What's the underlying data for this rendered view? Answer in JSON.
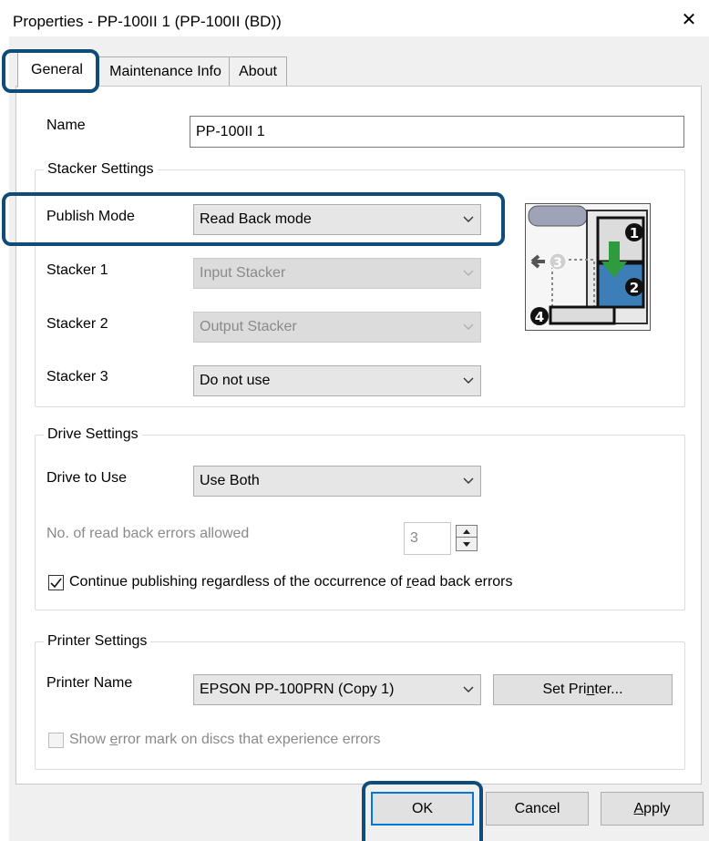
{
  "window": {
    "title": "Properties - PP-100II 1 (PP-100II (BD))",
    "close_glyph": "✕"
  },
  "tabs": [
    {
      "label": "General",
      "active": true
    },
    {
      "label": "Maintenance Info",
      "active": false
    },
    {
      "label": "About",
      "active": false
    }
  ],
  "general": {
    "name_label": "Name",
    "name_value": "PP-100II 1"
  },
  "stacker": {
    "group_title": "Stacker Settings",
    "publish_mode_label": "Publish Mode",
    "publish_mode_value": "Read Back mode",
    "stacker1_label": "Stacker 1",
    "stacker1_value": "Input Stacker",
    "stacker2_label": "Stacker 2",
    "stacker2_value": "Output Stacker",
    "stacker3_label": "Stacker 3",
    "stacker3_value": "Do not use",
    "diagram_numbers": [
      "1",
      "2",
      "3",
      "4"
    ]
  },
  "drive": {
    "group_title": "Drive Settings",
    "drive_label": "Drive to Use",
    "drive_value": "Use Both",
    "errors_label": "No. of read back errors allowed",
    "errors_value": "3",
    "continue_checked": true,
    "continue_label_pre": "Continue publishing regardless of the occurrence of ",
    "continue_label_key": "r",
    "continue_label_post": "ead back errors"
  },
  "printer": {
    "group_title": "Printer Settings",
    "printer_name_label": "Printer Name",
    "printer_name_value": "EPSON PP-100PRN (Copy 1)",
    "set_printer_pre": "Set Pri",
    "set_printer_key": "n",
    "set_printer_post": "ter...",
    "error_mark_checked": false,
    "error_mark_pre": "Show ",
    "error_mark_key": "e",
    "error_mark_post": "rror mark on discs that experience errors"
  },
  "buttons": {
    "ok": "OK",
    "cancel": "Cancel",
    "apply_key": "A",
    "apply_post": "pply"
  },
  "colors": {
    "highlight": "#0f4c78",
    "focus_blue": "#0078d7",
    "disabled_text": "#8a8a8a",
    "diagram_green": "#2e9b3e",
    "diagram_blue": "#3c7fb8"
  }
}
